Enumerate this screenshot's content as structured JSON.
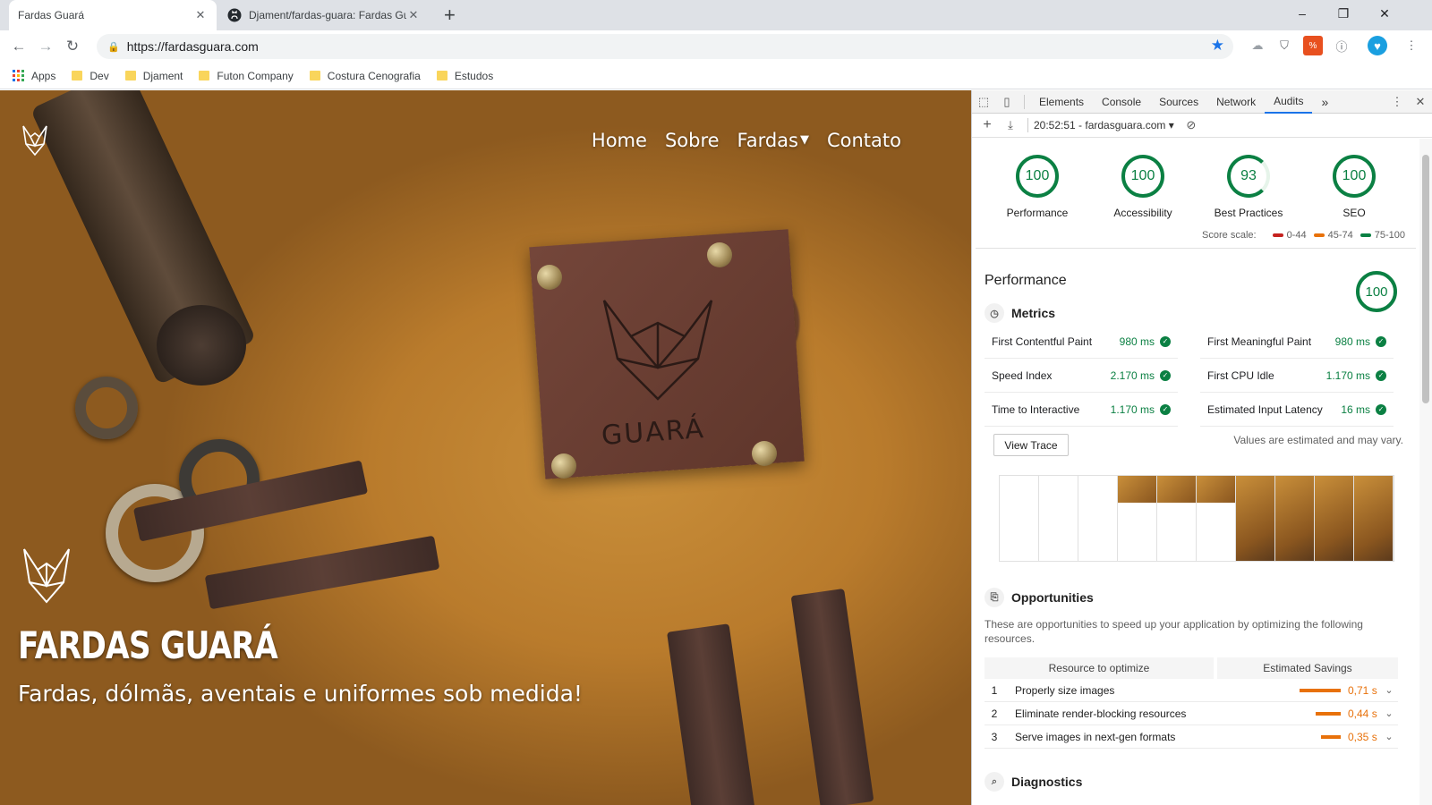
{
  "browser": {
    "tabs": [
      {
        "title": "Fardas Guará",
        "active": true
      },
      {
        "title": "Djament/fardas-guara: Fardas Gu",
        "active": false
      }
    ],
    "new_tab": "+",
    "window_controls": [
      "–",
      "❐",
      "✕"
    ],
    "url": "https://fardasguara.com",
    "bookmarks": [
      {
        "label": "Apps",
        "icon": "apps-grid-icon"
      },
      {
        "label": "Dev",
        "icon": "folder-icon"
      },
      {
        "label": "Djament",
        "icon": "folder-icon"
      },
      {
        "label": "Futon Company",
        "icon": "folder-icon"
      },
      {
        "label": "Costura Cenografia",
        "icon": "folder-icon"
      },
      {
        "label": "Estudos",
        "icon": "folder-icon"
      }
    ]
  },
  "site": {
    "nav": [
      "Home",
      "Sobre",
      "Fardas",
      "Contato"
    ],
    "patch_text": "GUARÁ",
    "hero_title": "FARDAS GUARÁ",
    "hero_subtitle": "Fardas, dólmãs, aventais e uniformes sob medida!"
  },
  "devtools": {
    "tabs": [
      "Elements",
      "Console",
      "Sources",
      "Network",
      "Audits",
      "»"
    ],
    "active_tab": "Audits",
    "report_label": "20:52:51 - fardasguara.com ▾",
    "gauges": [
      {
        "label": "Performance",
        "score": "100"
      },
      {
        "label": "Accessibility",
        "score": "100"
      },
      {
        "label": "Best Practices",
        "score": "93"
      },
      {
        "label": "SEO",
        "score": "100"
      }
    ],
    "scale": {
      "title": "Score scale:",
      "ranges": [
        "0-44",
        "45-74",
        "75-100"
      ],
      "colors": [
        "#c5221f",
        "#e8710a",
        "#0b8043"
      ]
    },
    "performance": {
      "title": "Performance",
      "score": "100",
      "metrics_title": "Metrics",
      "metrics": [
        {
          "name": "First Contentful Paint",
          "value": "980 ms"
        },
        {
          "name": "First Meaningful Paint",
          "value": "980 ms"
        },
        {
          "name": "Speed Index",
          "value": "2.170 ms"
        },
        {
          "name": "First CPU Idle",
          "value": "1.170 ms"
        },
        {
          "name": "Time to Interactive",
          "value": "1.170 ms"
        },
        {
          "name": "Estimated Input Latency",
          "value": "16 ms"
        }
      ],
      "view_trace": "View Trace",
      "estimate_note": "Values are estimated and may vary."
    },
    "opportunities": {
      "title": "Opportunities",
      "description": "These are opportunities to speed up your application by optimizing the following resources.",
      "col_resource": "Resource to optimize",
      "col_savings": "Estimated Savings",
      "rows": [
        {
          "num": "1",
          "name": "Properly size images",
          "savings": "0,71 s"
        },
        {
          "num": "2",
          "name": "Eliminate render-blocking resources",
          "savings": "0,44 s"
        },
        {
          "num": "3",
          "name": "Serve images in next-gen formats",
          "savings": "0,35 s"
        }
      ]
    },
    "diagnostics_title": "Diagnostics"
  }
}
